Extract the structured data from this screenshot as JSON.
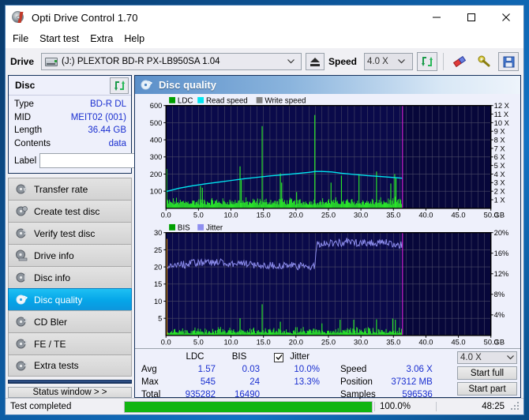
{
  "window": {
    "title": "Opti Drive Control 1.70",
    "icon": "disc-icon",
    "minimize": "minimize-icon",
    "maximize": "maximize-icon",
    "close": "close-icon"
  },
  "menubar": {
    "items": [
      "File",
      "Start test",
      "Extra",
      "Help"
    ]
  },
  "toolbar": {
    "drive_label": "Drive",
    "drive_value": "(J:)  PLEXTOR BD-R  PX-LB950SA 1.04",
    "eject": "eject-icon",
    "speed_label": "Speed",
    "speed_value": "4.0 X",
    "refresh": "refresh-icon",
    "erase": "erase-icon",
    "tools": "tools-icon",
    "save": "save-icon"
  },
  "disc_panel": {
    "title": "Disc",
    "refresh": "refresh-icon",
    "rows": [
      {
        "key": "Type",
        "value": "BD-R DL"
      },
      {
        "key": "MID",
        "value": "MEIT02 (001)"
      },
      {
        "key": "Length",
        "value": "36.44 GB"
      },
      {
        "key": "Contents",
        "value": "data"
      }
    ],
    "label_key": "Label",
    "label_value": "",
    "label_placeholder": "",
    "cd_button": "disc-icon"
  },
  "sidebar": {
    "items": [
      {
        "label": "Transfer rate",
        "icon": "disc-transfer-icon",
        "active": false
      },
      {
        "label": "Create test disc",
        "icon": "disc-create-icon",
        "active": false
      },
      {
        "label": "Verify test disc",
        "icon": "disc-verify-icon",
        "active": false
      },
      {
        "label": "Drive info",
        "icon": "disc-drive-icon",
        "active": false
      },
      {
        "label": "Disc info",
        "icon": "disc-info-icon",
        "active": false
      },
      {
        "label": "Disc quality",
        "icon": "disc-quality-icon",
        "active": true
      },
      {
        "label": "CD Bler",
        "icon": "disc-bler-icon",
        "active": false
      },
      {
        "label": "FE / TE",
        "icon": "disc-fete-icon",
        "active": false
      },
      {
        "label": "Extra tests",
        "icon": "disc-extra-icon",
        "active": false
      }
    ],
    "status_button": "Status window > >"
  },
  "main": {
    "title": "Disc quality",
    "icon": "disc-quality-icon"
  },
  "stats": {
    "col_ldc": "LDC",
    "col_bis": "BIS",
    "jitter_label": "Jitter",
    "jitter_checked": true,
    "rows": [
      {
        "name": "Avg",
        "ldc": "1.57",
        "bis": "0.03",
        "jitter": "10.0%"
      },
      {
        "name": "Max",
        "ldc": "545",
        "bis": "24",
        "jitter": "13.3%"
      },
      {
        "name": "Total",
        "ldc": "935282",
        "bis": "16490",
        "jitter": ""
      }
    ],
    "speed_label": "Speed",
    "speed_value": "3.06 X",
    "position_label": "Position",
    "position_value": "37312 MB",
    "samples_label": "Samples",
    "samples_value": "596536",
    "speed_select": "4.0 X",
    "start_full": "Start full",
    "start_part": "Start part"
  },
  "statusbar": {
    "text": "Test completed",
    "progress": 100,
    "percent": "100.0%",
    "time": "48:25"
  },
  "colors": {
    "accent": "#05a5e8",
    "plot_bg": "#0a0a4a",
    "ldc_green": "#00d000",
    "read_speed": "#00e5f0",
    "write_speed": "#808080",
    "jitter_violet": "#8f8ff0",
    "marker_magenta": "#cc00cc",
    "progress_green": "#11b511",
    "value_blue": "#1a2fd0"
  },
  "chart_data": [
    {
      "type": "line",
      "name": "quality-top-chart",
      "title": "",
      "xlabel": "GB",
      "ylabel": "LDC",
      "legend": [
        {
          "label": "LDC",
          "color": "#00a000"
        },
        {
          "label": "Read speed",
          "color": "#00e5f0"
        },
        {
          "label": "Write speed",
          "color": "#808080"
        }
      ],
      "legend_position": "top-left",
      "grid": true,
      "xlim": [
        0,
        50
      ],
      "xticks": [
        "0.0",
        "5.0",
        "10.0",
        "15.0",
        "20.0",
        "25.0",
        "30.0",
        "35.0",
        "40.0",
        "45.0",
        "50.0"
      ],
      "ylim": [
        0,
        600
      ],
      "yticks": [
        "100",
        "200",
        "300",
        "400",
        "500",
        "600"
      ],
      "y2lim": [
        0,
        12
      ],
      "y2ticks": [
        "1 X",
        "2 X",
        "3 X",
        "4 X",
        "5 X",
        "6 X",
        "7 X",
        "8 X",
        "9 X",
        "10 X",
        "11 X",
        "12 X"
      ],
      "data_end_x": 36.4,
      "marker_x": 36.4,
      "series": [
        {
          "name": "Read speed",
          "color": "#00e5f0",
          "axis": "right",
          "points": [
            [
              0.0,
              1.95
            ],
            [
              2.0,
              2.35
            ],
            [
              4.0,
              2.62
            ],
            [
              6.0,
              2.85
            ],
            [
              8.0,
              3.05
            ],
            [
              10.0,
              3.25
            ],
            [
              12.0,
              3.45
            ],
            [
              14.0,
              3.62
            ],
            [
              16.0,
              3.78
            ],
            [
              18.0,
              3.92
            ],
            [
              20.0,
              4.05
            ],
            [
              22.0,
              4.2
            ],
            [
              23.0,
              4.3
            ],
            [
              24.0,
              4.3
            ],
            [
              25.5,
              4.25
            ],
            [
              27.0,
              4.1
            ],
            [
              29.0,
              3.95
            ],
            [
              31.0,
              3.82
            ],
            [
              33.0,
              3.72
            ],
            [
              35.0,
              3.6
            ],
            [
              36.4,
              3.52
            ]
          ]
        },
        {
          "name": "LDC",
          "color": "#00d000",
          "axis": "left",
          "baseline_noise": [
            20,
            60
          ],
          "spikes": [
            [
              0.1,
              230
            ],
            [
              5.3,
              130
            ],
            [
              5.6,
              120
            ],
            [
              11.4,
              245
            ],
            [
              11.6,
              165
            ],
            [
              14.8,
              480
            ],
            [
              17.6,
              205
            ],
            [
              17.8,
              150
            ],
            [
              20.1,
              95
            ],
            [
              22.9,
              545
            ],
            [
              25.4,
              150
            ],
            [
              27.0,
              190
            ],
            [
              29.7,
              200
            ],
            [
              32.4,
              215
            ],
            [
              34.6,
              145
            ],
            [
              35.2,
              200
            ],
            [
              35.4,
              175
            ]
          ]
        }
      ]
    },
    {
      "type": "line",
      "name": "quality-bottom-chart",
      "title": "",
      "xlabel": "GB",
      "ylabel": "BIS",
      "legend": [
        {
          "label": "BIS",
          "color": "#00a000"
        },
        {
          "label": "Jitter",
          "color": "#8f8ff0"
        }
      ],
      "legend_position": "top-left",
      "grid": true,
      "xlim": [
        0,
        50
      ],
      "xticks": [
        "0.0",
        "5.0",
        "10.0",
        "15.0",
        "20.0",
        "25.0",
        "30.0",
        "35.0",
        "40.0",
        "45.0",
        "50.0"
      ],
      "ylim": [
        0,
        30
      ],
      "yticks": [
        "5",
        "10",
        "15",
        "20",
        "25",
        "30"
      ],
      "y2lim": [
        0,
        20
      ],
      "y2ticks": [
        "4%",
        "8%",
        "12%",
        "16%",
        "20%"
      ],
      "data_end_x": 36.4,
      "marker_x": 36.4,
      "series": [
        {
          "name": "Jitter",
          "color": "#8f8ff0",
          "axis": "right",
          "points": [
            [
              0.2,
              12.9
            ],
            [
              1.0,
              13.6
            ],
            [
              2.0,
              14.1
            ],
            [
              3.0,
              13.8
            ],
            [
              4.0,
              14.0
            ],
            [
              5.0,
              14.2
            ],
            [
              6.0,
              14.0
            ],
            [
              7.0,
              14.3
            ],
            [
              8.0,
              14.1
            ],
            [
              9.0,
              14.4
            ],
            [
              10.0,
              14.0
            ],
            [
              11.0,
              14.2
            ],
            [
              12.0,
              13.9
            ],
            [
              13.0,
              13.8
            ],
            [
              14.0,
              13.7
            ],
            [
              15.0,
              13.6
            ],
            [
              16.0,
              13.7
            ],
            [
              17.0,
              13.6
            ],
            [
              18.0,
              13.5
            ],
            [
              19.0,
              13.6
            ],
            [
              20.0,
              13.5
            ],
            [
              21.0,
              13.4
            ],
            [
              22.0,
              13.4
            ],
            [
              22.9,
              13.3
            ],
            [
              23.2,
              17.8
            ],
            [
              24.0,
              18.0
            ],
            [
              25.0,
              17.9
            ],
            [
              26.0,
              18.1
            ],
            [
              27.0,
              18.0
            ],
            [
              28.0,
              18.3
            ],
            [
              29.0,
              18.0
            ],
            [
              30.0,
              18.2
            ],
            [
              31.0,
              18.0
            ],
            [
              32.0,
              18.1
            ],
            [
              33.0,
              17.9
            ],
            [
              34.0,
              18.0
            ],
            [
              35.0,
              17.8
            ],
            [
              36.4,
              17.6
            ]
          ]
        },
        {
          "name": "BIS",
          "color": "#00d000",
          "axis": "left",
          "baseline_noise": [
            0.5,
            2.2
          ],
          "spikes": [
            [
              11.4,
              5.0
            ],
            [
              14.8,
              9.1
            ],
            [
              17.6,
              4.0
            ],
            [
              24.0,
              3.5
            ],
            [
              26.8,
              4.6
            ],
            [
              28.9,
              4.6
            ],
            [
              32.4,
              4.7
            ],
            [
              34.9,
              4.9
            ],
            [
              35.3,
              4.6
            ]
          ]
        }
      ]
    }
  ]
}
